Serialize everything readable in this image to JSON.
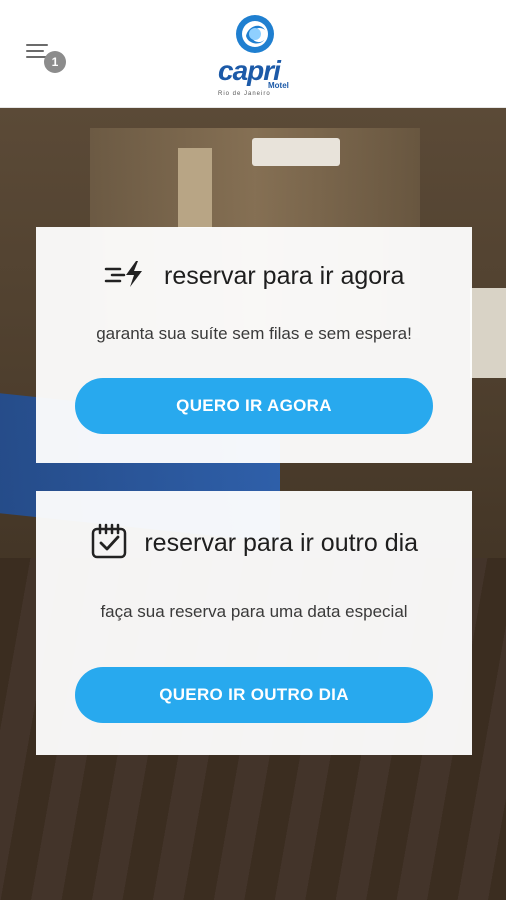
{
  "header": {
    "menu_badge": "1",
    "logo": {
      "name": "capri",
      "sub": "Motel",
      "location": "Rio de Janeiro"
    }
  },
  "cards": [
    {
      "icon": "fast-lightning-icon",
      "title": "reservar para ir agora",
      "description": "garanta sua suíte sem filas e sem espera!",
      "button": "QUERO IR AGORA"
    },
    {
      "icon": "calendar-check-icon",
      "title": "reservar para ir outro dia",
      "description": "faça sua reserva para uma data especial",
      "button": "QUERO IR OUTRO DIA"
    }
  ],
  "colors": {
    "accent": "#28a9ee",
    "brand": "#1c5aa8"
  }
}
